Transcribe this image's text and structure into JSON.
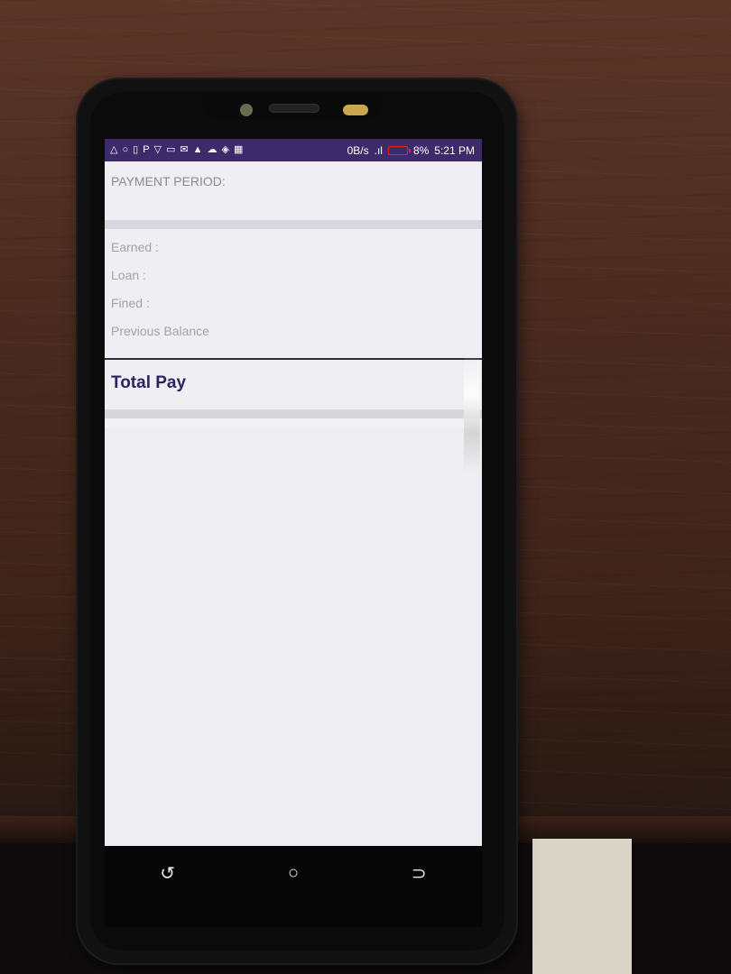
{
  "status_bar": {
    "net_speed": "0B/s",
    "battery_percent": "8%",
    "time": "5:21 PM",
    "icons": [
      "warning-triangle-icon",
      "circle-icon",
      "p-icon",
      "shirt-icon",
      "mail-icon",
      "alert-icon",
      "cloud-icon",
      "shield-icon",
      "signal-icon"
    ]
  },
  "payment": {
    "period_label": "PAYMENT PERIOD:"
  },
  "summary": {
    "earned_label": "Earned :",
    "loan_label": "Loan :",
    "fined_label": "Fined :",
    "previous_balance_label": "Previous Balance",
    "total_pay_label": "Total Pay"
  },
  "nav": {
    "back_icon": "recent-apps-icon",
    "home_icon": "home-icon",
    "return_icon": "back-icon"
  },
  "colors": {
    "status_bar": "#3c2a6a",
    "total_pay_text": "#2a2560",
    "battery_low": "#e22222"
  }
}
